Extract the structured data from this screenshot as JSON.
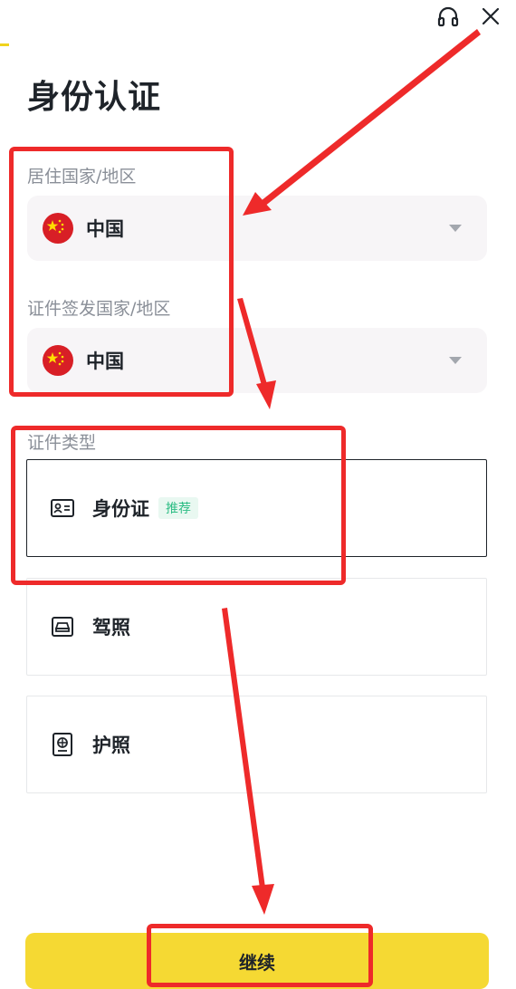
{
  "header": {
    "title": "身份认证",
    "support_icon": "headset-icon",
    "close_icon": "close-icon"
  },
  "residence": {
    "label": "居住国家/地区",
    "value": "中国",
    "flag_icon": "china-flag-icon"
  },
  "issuing": {
    "label": "证件签发国家/地区",
    "value": "中国",
    "flag_icon": "china-flag-icon"
  },
  "document_type": {
    "label": "证件类型",
    "options": [
      {
        "label": "身份证",
        "badge": "推荐",
        "icon": "id-card-icon",
        "selected": true
      },
      {
        "label": "驾照",
        "icon": "car-icon",
        "selected": false
      },
      {
        "label": "护照",
        "icon": "passport-icon",
        "selected": false
      }
    ]
  },
  "actions": {
    "continue_label": "继续"
  },
  "colors": {
    "accent_yellow": "#f5d933",
    "annotation_red": "#ee2a2a",
    "badge_green": "#2ebd85",
    "flag_red": "#d81f26"
  }
}
